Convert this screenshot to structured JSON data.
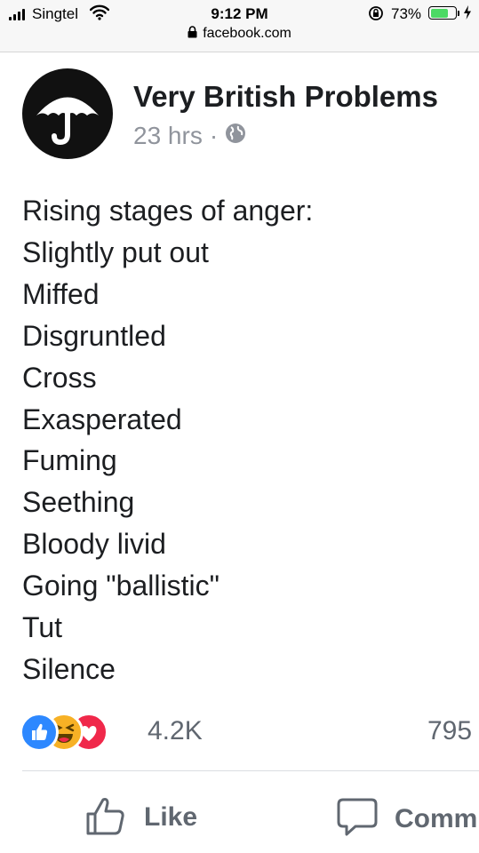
{
  "status_bar": {
    "carrier": "Singtel",
    "time": "9:12 PM",
    "battery_percent": "73%",
    "battery_level": 0.73,
    "url": "facebook.com"
  },
  "post": {
    "page_name": "Very British Problems",
    "timestamp": "23 hrs",
    "separator": "·",
    "audience_icon": "globe-icon",
    "lines": [
      "Rising stages of anger:",
      "Slightly put out",
      "Miffed",
      "Disgruntled",
      "Cross",
      "Exasperated",
      "Fuming",
      "Seething",
      "Bloody livid",
      "Going \"ballistic\"",
      "Tut",
      "Silence"
    ]
  },
  "engagement": {
    "reaction_icons": [
      "like-reaction-icon",
      "haha-reaction-icon",
      "love-reaction-icon"
    ],
    "reaction_count": "4.2K",
    "comment_count": "795"
  },
  "actions": {
    "like_label": "Like",
    "comment_label": "Comm"
  },
  "colors": {
    "like_blue": "#2d88ff",
    "haha_yellow": "#f7b125",
    "love_red": "#f0284a",
    "battery_green": "#4cd964",
    "meta_gray": "#90949c"
  }
}
